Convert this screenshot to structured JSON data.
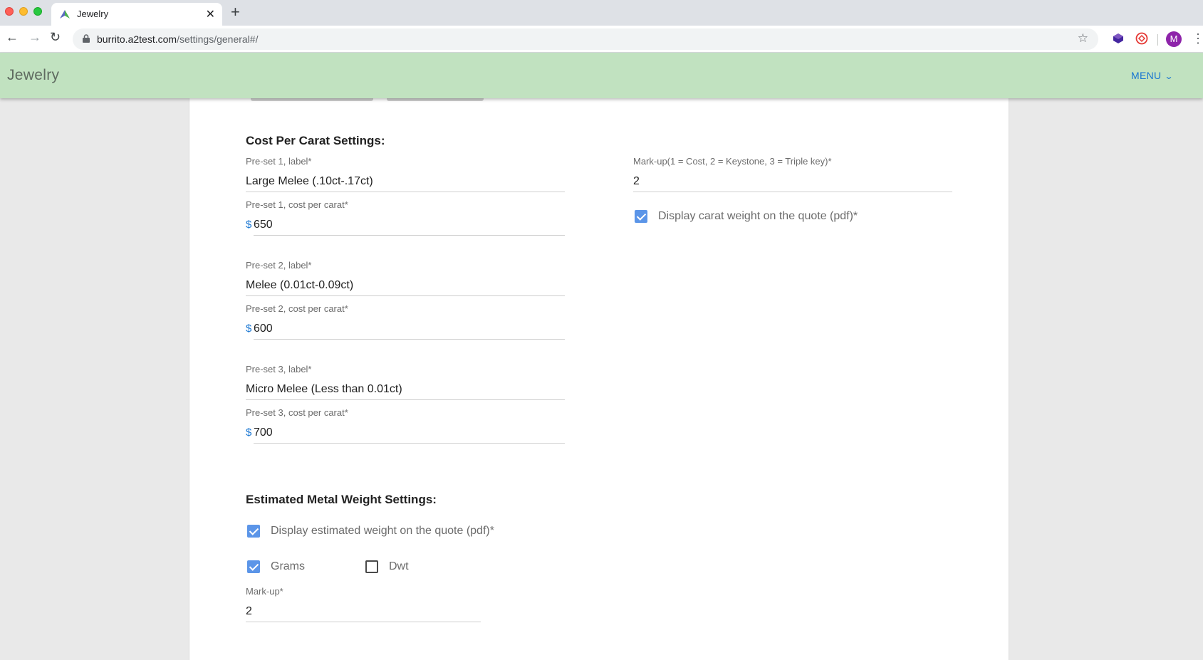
{
  "browser": {
    "tab_title": "Jewelry",
    "url_host": "burrito.a2test.com",
    "url_path": "/settings/general#/",
    "profile_initial": "M"
  },
  "app": {
    "title": "Jewelry",
    "menu_label": "MENU"
  },
  "cost_per_carat": {
    "heading": "Cost Per Carat Settings:",
    "currency_symbol": "$",
    "preset1": {
      "label_caption": "Pre-set 1, label*",
      "label_value": "Large Melee (.10ct-.17ct)",
      "cost_caption": "Pre-set 1, cost per carat*",
      "cost_value": "650"
    },
    "preset2": {
      "label_caption": "Pre-set 2, label*",
      "label_value": "Melee (0.01ct-0.09ct)",
      "cost_caption": "Pre-set 2, cost per carat*",
      "cost_value": "600"
    },
    "preset3": {
      "label_caption": "Pre-set 3, label*",
      "label_value": "Micro Melee (Less than 0.01ct)",
      "cost_caption": "Pre-set 3, cost per carat*",
      "cost_value": "700"
    },
    "markup_caption": "Mark-up(1 = Cost, 2 = Keystone, 3 = Triple key)*",
    "markup_value": "2",
    "display_carat_label": "Display carat weight on the quote (pdf)*",
    "display_carat_checked": true
  },
  "metal_weight": {
    "heading": "Estimated Metal Weight Settings:",
    "display_weight_label": "Display estimated weight on the quote (pdf)*",
    "display_weight_checked": true,
    "grams_label": "Grams",
    "grams_checked": true,
    "dwt_label": "Dwt",
    "dwt_checked": false,
    "markup_caption": "Mark-up*",
    "markup_value": "2"
  },
  "colors": {
    "header_bg": "#c1e2c0",
    "accent_blue": "#1976d2",
    "checkbox_blue": "#5b95e8"
  }
}
